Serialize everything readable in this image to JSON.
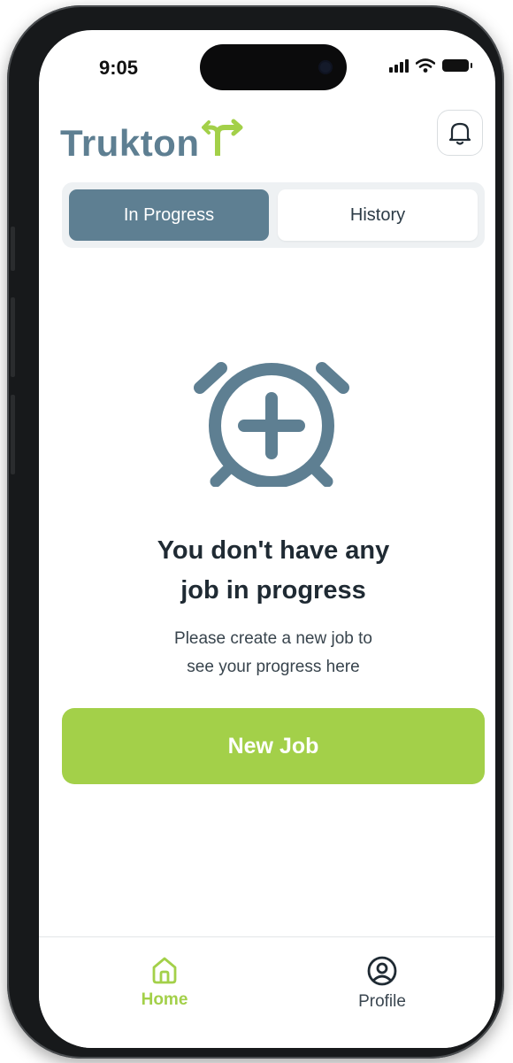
{
  "status_bar": {
    "time": "9:05"
  },
  "header": {
    "logo_text": "Trukton",
    "notification_icon": "bell-icon"
  },
  "tabs": [
    {
      "label": "In Progress",
      "selected": true
    },
    {
      "label": "History",
      "selected": false
    }
  ],
  "empty_state": {
    "icon": "alarm-clock-plus-icon",
    "title_line1": "You don't have any",
    "title_line2": "job in progress",
    "subtitle_line1": "Please create a new job to",
    "subtitle_line2": "see your progress here"
  },
  "new_job_button": {
    "label": "New Job"
  },
  "bottom_nav": [
    {
      "label": "Home",
      "icon": "home-icon",
      "active": true
    },
    {
      "label": "Profile",
      "icon": "user-circle-icon",
      "active": false
    }
  ],
  "colors": {
    "brand_slate": "#5e7f92",
    "accent_green": "#a3d049",
    "title_text": "#1f2a33",
    "segment_bg": "#eef1f3"
  }
}
